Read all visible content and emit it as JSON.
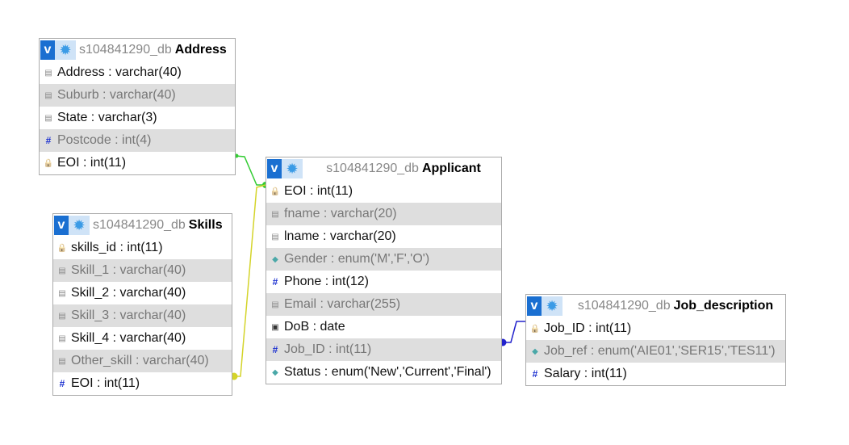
{
  "tables": [
    {
      "id": "address",
      "db": "s104841290_db",
      "name": "Address",
      "columns": [
        {
          "icon": "text-icon",
          "label": "Address : varchar(40)"
        },
        {
          "icon": "text-icon",
          "label": "Suburb : varchar(40)"
        },
        {
          "icon": "text-icon",
          "label": "State : varchar(3)"
        },
        {
          "icon": "number-icon",
          "label": "Postcode : int(4)"
        },
        {
          "icon": "key-icon",
          "label": "EOI : int(11)"
        }
      ]
    },
    {
      "id": "skills",
      "db": "s104841290_db",
      "name": "Skills",
      "columns": [
        {
          "icon": "key-icon",
          "label": "skills_id : int(11)"
        },
        {
          "icon": "text-icon",
          "label": "Skill_1 : varchar(40)"
        },
        {
          "icon": "text-icon",
          "label": "Skill_2 : varchar(40)"
        },
        {
          "icon": "text-icon",
          "label": "Skill_3 : varchar(40)"
        },
        {
          "icon": "text-icon",
          "label": "Skill_4 : varchar(40)"
        },
        {
          "icon": "text-icon",
          "label": "Other_skill : varchar(40)"
        },
        {
          "icon": "number-icon",
          "label": "EOI : int(11)"
        }
      ]
    },
    {
      "id": "applicant",
      "db": "s104841290_db",
      "name": "Applicant",
      "columns": [
        {
          "icon": "key-icon",
          "label": "EOI : int(11)"
        },
        {
          "icon": "text-icon",
          "label": "fname : varchar(20)"
        },
        {
          "icon": "text-icon",
          "label": "lname : varchar(20)"
        },
        {
          "icon": "enum-icon",
          "label": "Gender : enum('M','F','O')"
        },
        {
          "icon": "number-icon",
          "label": "Phone : int(12)"
        },
        {
          "icon": "text-icon",
          "label": "Email : varchar(255)"
        },
        {
          "icon": "date-icon",
          "label": "DoB : date"
        },
        {
          "icon": "number-icon",
          "label": "Job_ID : int(11)"
        },
        {
          "icon": "enum-icon",
          "label": "Status : enum('New','Current','Final')"
        }
      ]
    },
    {
      "id": "job_description",
      "db": "s104841290_db",
      "name": "Job_description",
      "columns": [
        {
          "icon": "key-icon",
          "label": "Job_ID : int(11)"
        },
        {
          "icon": "enum-icon",
          "label": "Job_ref : enum('AIE01','SER15','TES11')"
        },
        {
          "icon": "number-icon",
          "label": "Salary : int(11)"
        }
      ]
    }
  ],
  "toggle_label": "v",
  "relations": [
    {
      "from": "Address.EOI",
      "to": "Applicant.EOI",
      "color": "#33cc33"
    },
    {
      "from": "Skills.EOI",
      "to": "Applicant.EOI",
      "color": "#d4d42a"
    },
    {
      "from": "Applicant.Job_ID",
      "to": "Job_description.Job_ID",
      "color": "#2222cc"
    }
  ]
}
